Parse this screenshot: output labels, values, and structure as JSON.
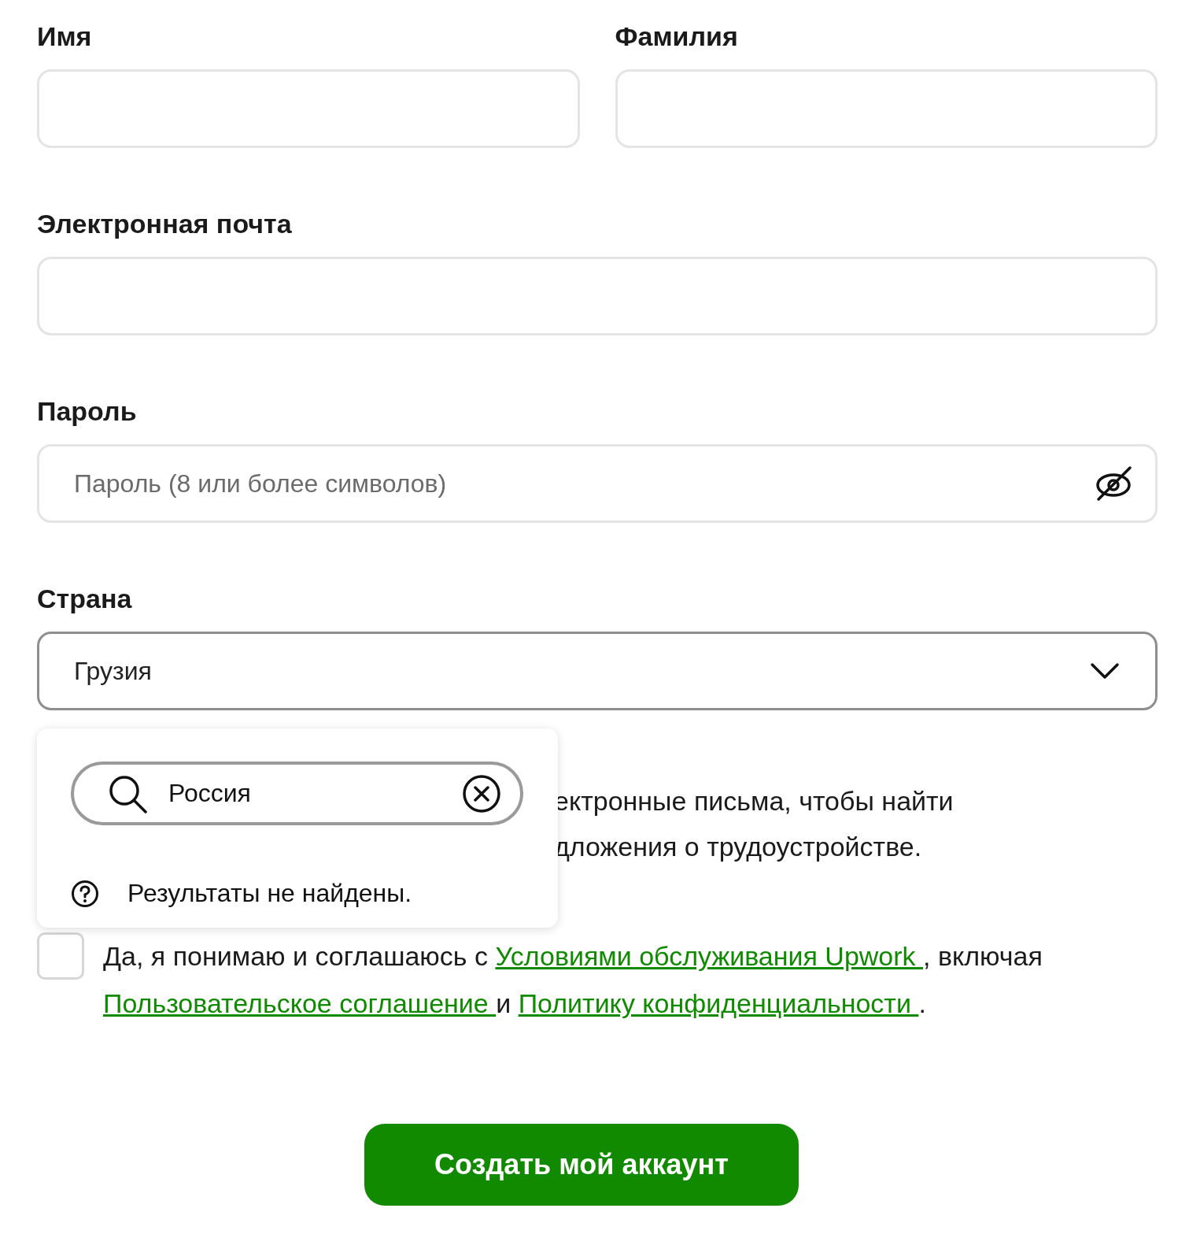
{
  "name_fields": [
    {
      "label": "Имя"
    },
    {
      "label": "Фамилия"
    }
  ],
  "email": {
    "label": "Электронная почта"
  },
  "password": {
    "label": "Пароль",
    "placeholder": "Пароль (8 или более символов)"
  },
  "country": {
    "label": "Страна",
    "value": "Грузия",
    "expanded": true
  },
  "country_dropdown": {
    "search_value": "Россия",
    "message": "Результаты не найдены."
  },
  "hidden_paragraph_lines": [
    "ектронные письма, чтобы найти",
    "дложения о трудоустройстве."
  ],
  "terms": {
    "checked": false,
    "parts": [
      {
        "kind": "text",
        "text": "Да, я понимаю и соглашаюсь с "
      },
      {
        "kind": "link",
        "text": "Условиями обслуживания Upwork "
      },
      {
        "kind": "text",
        "text": ", включая "
      },
      {
        "kind": "link",
        "text": "Пользовательское соглашение "
      },
      {
        "kind": "text",
        "text": "и "
      },
      {
        "kind": "link",
        "text": "Политику конфиденциальности "
      },
      {
        "kind": "text",
        "text": "."
      }
    ]
  },
  "submit": {
    "label": "Создать мой аккаунт"
  }
}
